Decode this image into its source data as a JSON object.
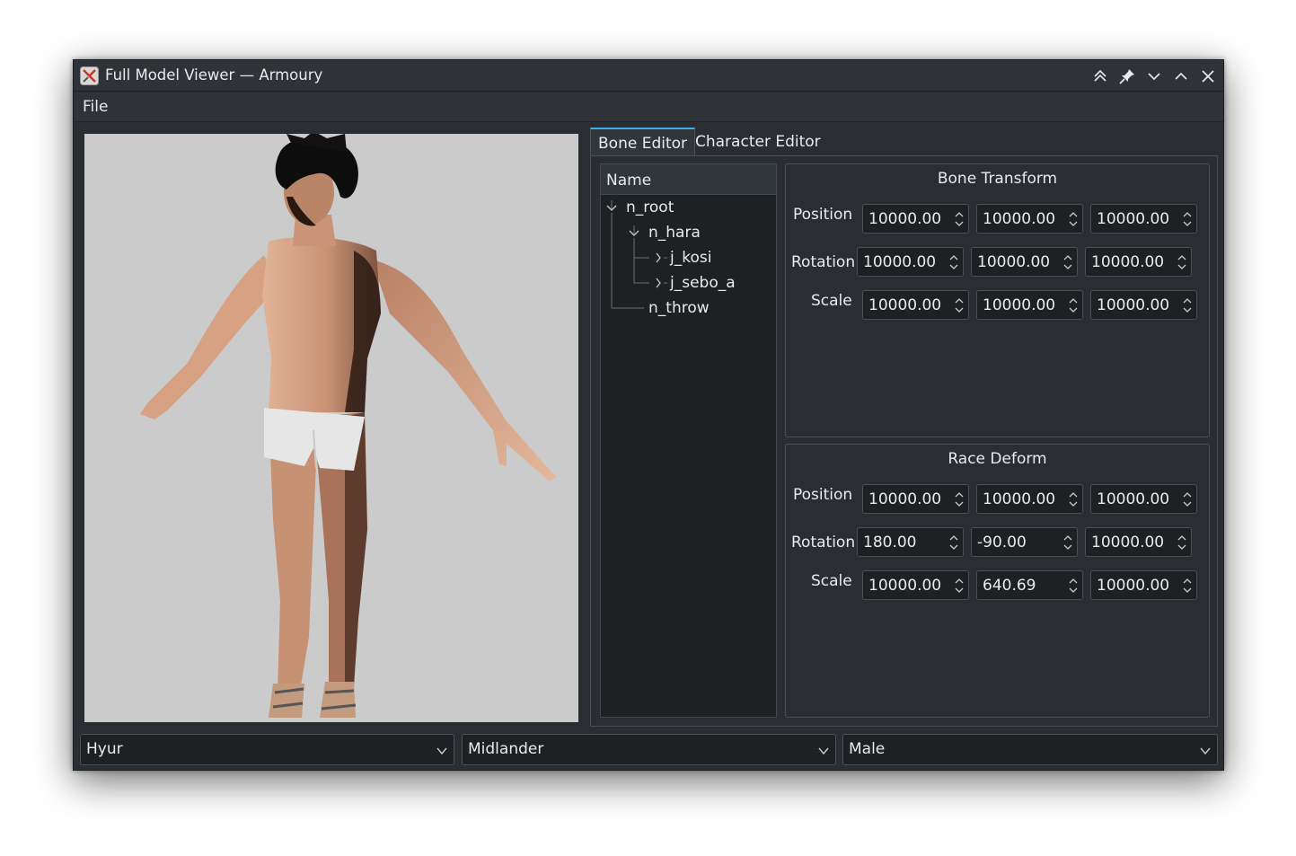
{
  "window": {
    "title": "Full Model Viewer — Armoury",
    "controls": [
      "keep-above-icon",
      "pin-icon",
      "minimize-icon",
      "maximize-icon",
      "close-icon"
    ]
  },
  "menu": {
    "file": "File"
  },
  "tabs": {
    "bone_editor": "Bone Editor",
    "character_editor": "Character Editor",
    "active": "Bone Editor"
  },
  "tree": {
    "header": "Name",
    "nodes": {
      "n_root": "n_root",
      "n_hara": "n_hara",
      "j_kosi": "j_kosi",
      "j_sebo_a": "j_sebo_a",
      "n_throw": "n_throw"
    }
  },
  "bone_transform": {
    "title": "Bone Transform",
    "labels": {
      "position": "Position",
      "rotation": "Rotation",
      "scale": "Scale"
    },
    "position": [
      "10000.00",
      "10000.00",
      "10000.00"
    ],
    "rotation": [
      "10000.00",
      "10000.00",
      "10000.00"
    ],
    "scale": [
      "10000.00",
      "10000.00",
      "10000.00"
    ]
  },
  "race_deform": {
    "title": "Race Deform",
    "labels": {
      "position": "Position",
      "rotation": "Rotation",
      "scale": "Scale"
    },
    "position": [
      "10000.00",
      "10000.00",
      "10000.00"
    ],
    "rotation": [
      "180.00",
      "-90.00",
      "10000.00"
    ],
    "scale": [
      "10000.00",
      "640.69",
      "10000.00"
    ]
  },
  "selectors": {
    "race": "Hyur",
    "subrace": "Midlander",
    "gender": "Male"
  },
  "colors": {
    "accent": "#3daee9",
    "window_bg": "#2a2e32",
    "field_bg": "#1e2124",
    "viewport_bg": "#cbcbcb",
    "skin": "#d9a98a"
  }
}
